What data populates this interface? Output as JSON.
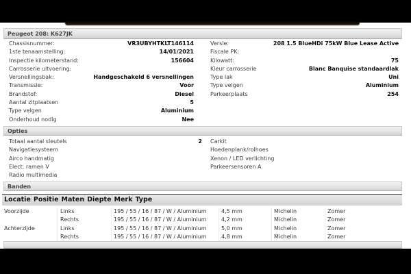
{
  "header": {
    "title": "Peugeot 208: K627JK"
  },
  "colors": {
    "section_bar_top": "#f1f1f1",
    "section_bar_bottom": "#d2d2d2",
    "label_text": "#3c3c3c",
    "value_text": "#0a0a0a",
    "background_band": "#000000"
  },
  "vehicle": {
    "left": [
      {
        "label": "Chassisnummer:",
        "value": "VR3UBYHTKLT146114"
      },
      {
        "label": "1ste tenaamstelling:",
        "value": "14/01/2021"
      },
      {
        "label": "Inspectie kilometerstand:",
        "value": "156604"
      },
      {
        "label": "Carrosserie uitvoering:",
        "value": ""
      },
      {
        "label": "Versnellingsbak:",
        "value": "Handgeschakeld 6 versnellingen"
      },
      {
        "label": "Transmissie:",
        "value": "Voor"
      },
      {
        "label": "Brandstof:",
        "value": "Diesel"
      },
      {
        "label": "Aantal zitplaatsen",
        "value": "5"
      },
      {
        "label": "Type velgen",
        "value": "Aluminium"
      },
      {
        "label": "Onderhoud nodig",
        "value": "Nee"
      }
    ],
    "right": [
      {
        "label": "Versie:",
        "value": "208 1.5 BlueHDi 75kW Blue Lease Active"
      },
      {
        "label": "Fiscale PK:",
        "value": ""
      },
      {
        "label": "Kilowatt:",
        "value": "75"
      },
      {
        "label": "Kleur carrosserie",
        "value": "Blanc Banquise standaardlak"
      },
      {
        "label": "Type lak",
        "value": "Uni"
      },
      {
        "label": "Type velgen",
        "value": "Aluminium"
      },
      {
        "label": "Parkeerplaats",
        "value": "254"
      }
    ]
  },
  "opties": {
    "title": "Opties",
    "left": [
      {
        "label": "Totaal aantal sleutels",
        "value": "2"
      },
      {
        "label": "Navigatiesysteem",
        "value": ""
      },
      {
        "label": "Airco handmatig",
        "value": ""
      },
      {
        "label": "Elect. ramen V",
        "value": ""
      },
      {
        "label": "Radio multimedia",
        "value": ""
      }
    ],
    "right": [
      {
        "label": "Carkit",
        "value": ""
      },
      {
        "label": "Hoedenplank/rolhoes",
        "value": ""
      },
      {
        "label": "Xenon / LED verlichting",
        "value": ""
      },
      {
        "label": "Parkeersensoren A",
        "value": ""
      }
    ]
  },
  "banden": {
    "title": "Banden",
    "columns": [
      "Locatie",
      "Positie",
      "Maten",
      "Diepte",
      "Merk",
      "Type"
    ],
    "rows": [
      [
        "Voorzijde",
        "Links",
        "195 / 55 / 16 / 87 / W / Aluminium",
        "4,5 mm",
        "Michelin",
        "Zomer"
      ],
      [
        "",
        "Rechts",
        "195 / 55 / 16 / 87 / W / Aluminium",
        "4,2 mm",
        "Michelin",
        "Zomer"
      ],
      [
        "Achterzijde",
        "Links",
        "195 / 55 / 16 / 87 / W / Aluminium",
        "5,0 mm",
        "Michelin",
        "Zomer"
      ],
      [
        "",
        "Rechts",
        "195 / 55 / 16 / 87 / W / Aluminium",
        "4,8 mm",
        "Michelin",
        "Zomer"
      ]
    ]
  }
}
